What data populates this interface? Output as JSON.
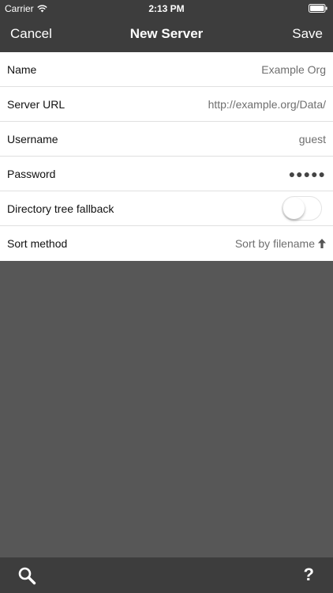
{
  "status_bar": {
    "carrier": "Carrier",
    "time": "2:13 PM"
  },
  "nav": {
    "cancel_label": "Cancel",
    "title": "New Server",
    "save_label": "Save"
  },
  "form": {
    "rows": [
      {
        "label": "Name",
        "value": "Example Org"
      },
      {
        "label": "Server URL",
        "value": "http://example.org/Data/"
      },
      {
        "label": "Username",
        "value": "guest"
      },
      {
        "label": "Password",
        "value": "●●●●●"
      },
      {
        "label": "Directory tree fallback",
        "toggle_on": false
      },
      {
        "label": "Sort method",
        "value": "Sort by filename"
      }
    ]
  },
  "toolbar": {
    "help_label": "?"
  },
  "icons": {
    "wifi": "wifi-icon",
    "battery": "battery-icon",
    "sort_direction": "arrow-up-icon",
    "search": "search-icon"
  },
  "colors": {
    "bar_background": "#3d3d3d",
    "content_background": "#575757",
    "row_background": "#ffffff",
    "value_text": "#6f6f6f"
  }
}
